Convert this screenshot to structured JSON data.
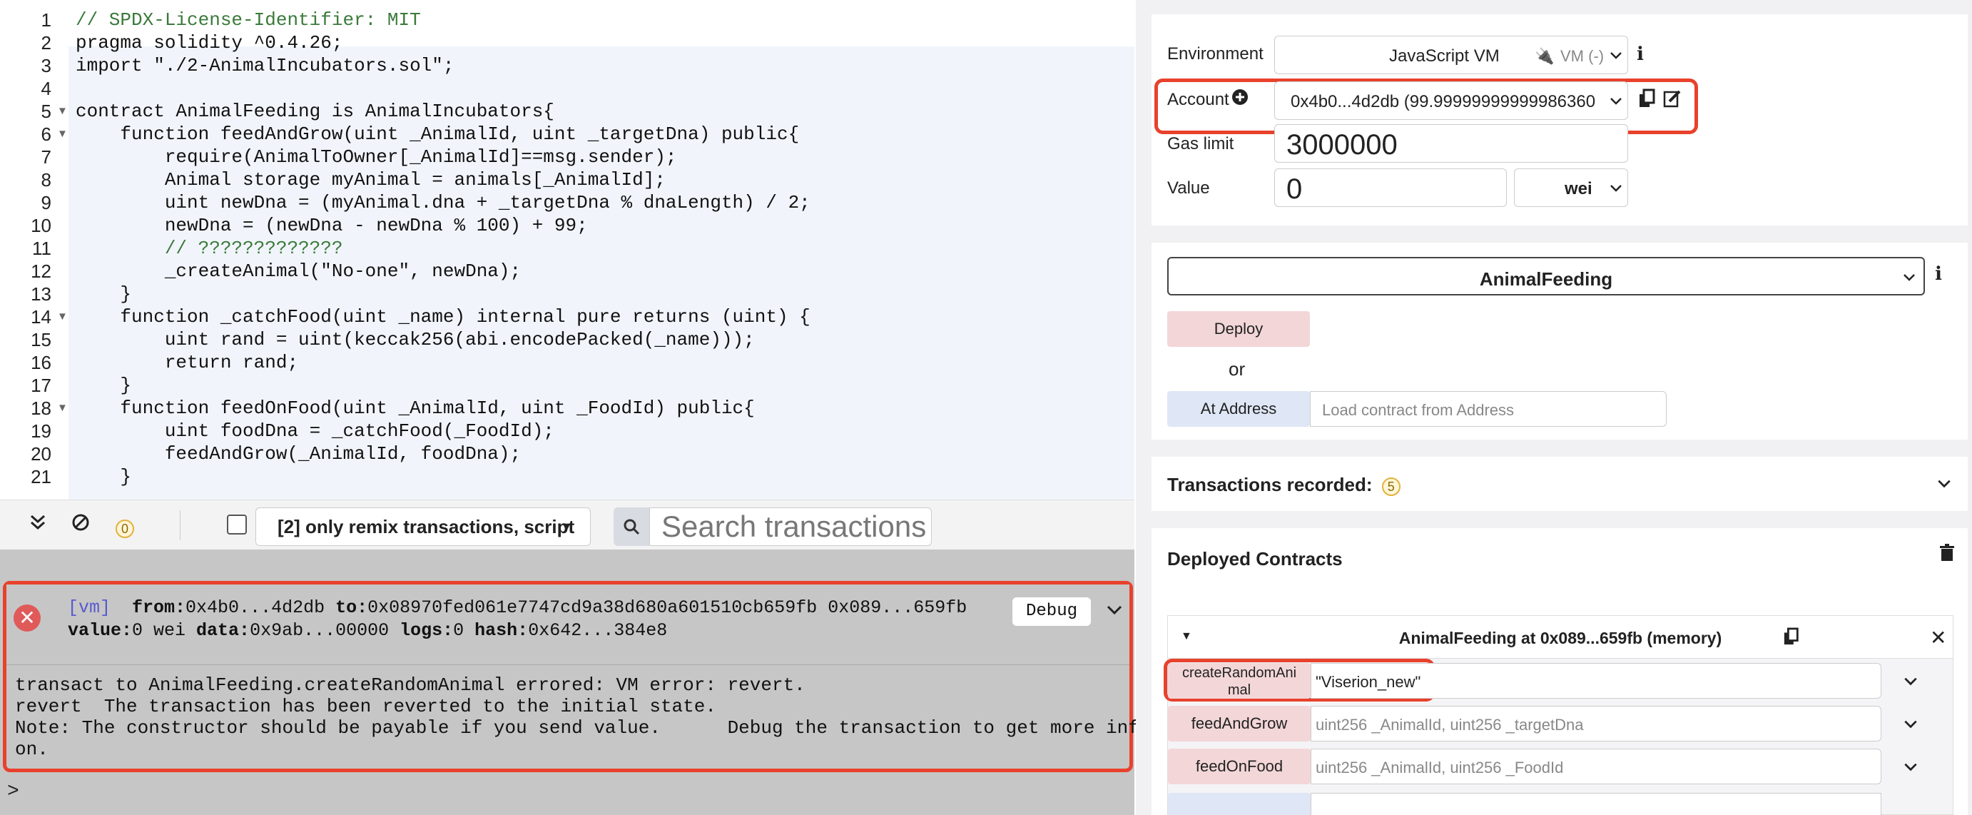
{
  "editor": {
    "lines": [
      {
        "n": "1",
        "text": "// SPDX-License-Identifier: MIT"
      },
      {
        "n": "2",
        "text": "pragma solidity ^0.4.26;"
      },
      {
        "n": "3",
        "text": "import \"./2-AnimalIncubators.sol\";"
      },
      {
        "n": "4",
        "text": ""
      },
      {
        "n": "5",
        "text": "contract AnimalFeeding is AnimalIncubators{"
      },
      {
        "n": "6",
        "text": "    function feedAndGrow(uint _AnimalId, uint _targetDna) public{"
      },
      {
        "n": "7",
        "text": "        require(AnimalToOwner[_AnimalId]==msg.sender);"
      },
      {
        "n": "8",
        "text": "        Animal storage myAnimal = animals[_AnimalId];"
      },
      {
        "n": "9",
        "text": "        uint newDna = (myAnimal.dna + _targetDna % dnaLength) / 2;"
      },
      {
        "n": "10",
        "text": "        newDna = (newDna - newDna % 100) + 99;"
      },
      {
        "n": "11",
        "text": "        // ?????????????"
      },
      {
        "n": "12",
        "text": "        _createAnimal(\"No-one\", newDna);"
      },
      {
        "n": "13",
        "text": "    }"
      },
      {
        "n": "14",
        "text": "    function _catchFood(uint _name) internal pure returns (uint) {"
      },
      {
        "n": "15",
        "text": "        uint rand = uint(keccak256(abi.encodePacked(_name)));"
      },
      {
        "n": "16",
        "text": "        return rand;"
      },
      {
        "n": "17",
        "text": "    }"
      },
      {
        "n": "18",
        "text": "    function feedOnFood(uint _AnimalId, uint _FoodId) public{"
      },
      {
        "n": "19",
        "text": "        uint foodDna = _catchFood(_FoodId);"
      },
      {
        "n": "20",
        "text": "        feedAndGrow(_AnimalId, foodDna);"
      },
      {
        "n": "21",
        "text": "    }"
      }
    ]
  },
  "terminal_bar": {
    "pending_count": "0",
    "filter_label": "[2] only remix transactions, script",
    "search_placeholder": "Search transactions"
  },
  "terminal": {
    "tag": "[vm]",
    "line1": {
      "from_label": "from:",
      "from": "0x4b0...4d2db",
      "to_label": "to:",
      "to": "0x08970fed061e7747cd9a38d680a601510cb659fb 0x089...659fb"
    },
    "line2": {
      "value_label": "value:",
      "value": "0 wei",
      "data_label": "data:",
      "data": "0x9ab...00000",
      "logs_label": "logs:",
      "logs": "0",
      "hash_label": "hash:",
      "hash": "0x642...384e8"
    },
    "debug_label": "Debug",
    "body": [
      "transact to AnimalFeeding.createRandomAnimal errored: VM error: revert.",
      "revert  The transaction has been reverted to the initial state.",
      "Note: The constructor should be payable if you send value.      Debug the transaction to get more informati",
      "on."
    ],
    "prompt": ">"
  },
  "run": {
    "environment_label": "Environment",
    "environment_value": "JavaScript VM",
    "environment_badge": "VM (-)",
    "account_label": "Account",
    "account_value": "0x4b0...4d2db (99.99999999999986360",
    "gas_label": "Gas limit",
    "gas_value": "3000000",
    "value_label": "Value",
    "value_amount": "0",
    "value_unit": "wei",
    "contract_select": "AnimalFeeding",
    "deploy_label": "Deploy",
    "or_label": "or",
    "at_address_label": "At Address",
    "at_address_placeholder": "Load contract from Address",
    "transactions_label": "Transactions recorded:",
    "transactions_count": "5",
    "deployed_label": "Deployed Contracts",
    "instance_title": "AnimalFeeding at 0x089...659fb (memory)",
    "functions": [
      {
        "name_line1": "createRandomAni",
        "name_line2": "mal",
        "value": "\"Viserion_new\"",
        "placeholder": ""
      },
      {
        "name_line1": "feedAndGrow",
        "name_line2": "",
        "value": "",
        "placeholder": "uint256 _AnimalId, uint256 _targetDna"
      },
      {
        "name_line1": "feedOnFood",
        "name_line2": "",
        "value": "",
        "placeholder": "uint256 _AnimalId, uint256 _FoodId"
      }
    ]
  },
  "colors": {
    "accent_red": "#e8412c",
    "deploy_pink": "#f3d6d8",
    "address_blue": "#dfe6f5"
  }
}
